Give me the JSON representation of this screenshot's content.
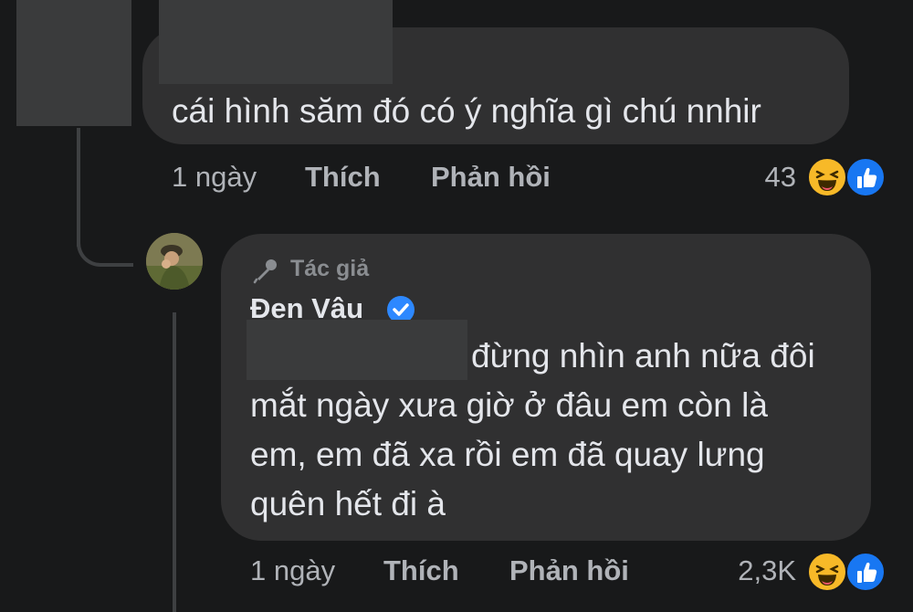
{
  "comment1": {
    "text": "cái hình săm đó có ý nghĩa gì chú nnhir",
    "time": "1 ngày",
    "like_label": "Thích",
    "reply_label": "Phản hồi",
    "reaction_count": "43",
    "reactions": [
      "haha-icon",
      "like-icon"
    ]
  },
  "reply1": {
    "author_badge": "Tác giả",
    "author_name": "Đen Vâu",
    "text_line1": "đừng nhìn anh nữa đôi",
    "text_line2": "mắt ngày xưa giờ ở đâu em còn là",
    "text_line3": "em, em đã xa rồi em đã quay lưng",
    "text_line4": "quên hết đi à",
    "time": "1 ngày",
    "like_label": "Thích",
    "reply_label": "Phản hồi",
    "reaction_count": "2,3K",
    "reactions": [
      "haha-icon",
      "like-icon"
    ]
  },
  "colors": {
    "background": "#18191a",
    "bubble": "#303031",
    "text": "#e4e6eb",
    "meta": "#b0b3b8",
    "verified": "#2d88ff"
  }
}
